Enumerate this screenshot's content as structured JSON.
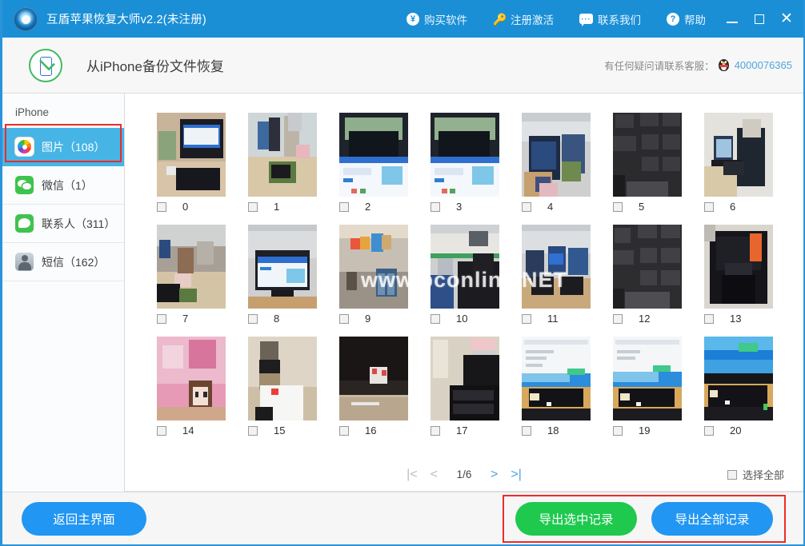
{
  "window": {
    "title": "互盾苹果恢复大师v2.2(未注册)",
    "logo_icon": "app-logo-icon",
    "menu": [
      {
        "label": "购买软件",
        "icon": "yuan-coin-icon"
      },
      {
        "label": "注册激活",
        "icon": "key-icon"
      },
      {
        "label": "联系我们",
        "icon": "chat-bubble-icon"
      },
      {
        "label": "帮助",
        "icon": "question-mark-icon"
      }
    ],
    "controls": {
      "minimize": "minimize-icon",
      "maximize": "maximize-icon",
      "close": "close-icon"
    },
    "titlebar_color": "#1a8fd6"
  },
  "subheader": {
    "badge_icon": "phone-check-icon",
    "title": "从iPhone备份文件恢复",
    "support_text": "有任何疑问请联系客服：",
    "qq_icon": "qq-penguin-icon",
    "support_number": "4000076365",
    "support_number_color": "#4da6dd"
  },
  "sidebar": {
    "header": "iPhone",
    "items": [
      {
        "label": "图片（108）",
        "icon": "photos-icon",
        "active": true,
        "highlighted": true
      },
      {
        "label": "微信（1）",
        "icon": "wechat-icon",
        "active": false,
        "highlighted": false
      },
      {
        "label": "联系人（311）",
        "icon": "contacts-icon",
        "active": false,
        "highlighted": false
      },
      {
        "label": "短信（162）",
        "icon": "sms-icon",
        "active": false,
        "highlighted": false
      }
    ],
    "active_color": "#47b4e6",
    "annotation_color": "#ef2b26"
  },
  "content": {
    "watermark": "www.pconline.NET",
    "thumbnails": [
      {
        "index": "0",
        "checked": false,
        "alt": "desk with monitor and keyboard"
      },
      {
        "index": "1",
        "checked": false,
        "alt": "office desk with mousepad"
      },
      {
        "index": "2",
        "checked": false,
        "alt": "monitor showing blue webpage"
      },
      {
        "index": "3",
        "checked": false,
        "alt": "monitor showing blue webpage"
      },
      {
        "index": "4",
        "checked": false,
        "alt": "open office with monitors"
      },
      {
        "index": "5",
        "checked": false,
        "alt": "close-up of black keyboard keys"
      },
      {
        "index": "6",
        "checked": false,
        "alt": "man working at laptop"
      },
      {
        "index": "7",
        "checked": false,
        "alt": "cluttered office desk"
      },
      {
        "index": "8",
        "checked": false,
        "alt": "monitor on desk in office"
      },
      {
        "index": "9",
        "checked": false,
        "alt": "water jugs beside shelf"
      },
      {
        "index": "10",
        "checked": false,
        "alt": "person in office chair"
      },
      {
        "index": "11",
        "checked": false,
        "alt": "office cubicles with monitors"
      },
      {
        "index": "12",
        "checked": false,
        "alt": "black keyboard close-up"
      },
      {
        "index": "13",
        "checked": false,
        "alt": "black computer mouse"
      },
      {
        "index": "14",
        "checked": false,
        "alt": "pink cartoon helmet"
      },
      {
        "index": "15",
        "checked": false,
        "alt": "cup and paper on desk"
      },
      {
        "index": "16",
        "checked": false,
        "alt": "dark fluffy cat"
      },
      {
        "index": "17",
        "checked": false,
        "alt": "glass and keyboard on desk"
      },
      {
        "index": "18",
        "checked": false,
        "alt": "monitor with blue page and desk"
      },
      {
        "index": "19",
        "checked": false,
        "alt": "monitor with blue page and desk"
      },
      {
        "index": "20",
        "checked": false,
        "alt": "bright blue monitor screen"
      }
    ],
    "pager": {
      "first_icon": "first-page-icon",
      "first_label": "|<",
      "prev_icon": "prev-page-icon",
      "prev_label": "<",
      "current": "1/6",
      "next_icon": "next-page-icon",
      "next_label": ">",
      "last_icon": "last-page-icon",
      "last_label": ">|"
    },
    "select_all": {
      "label": "选择全部",
      "checked": false
    }
  },
  "footer": {
    "back_label": "返回主界面",
    "export_selected_label": "导出选中记录",
    "export_all_label": "导出全部记录",
    "blue": "#2196f3",
    "green": "#1ec94e",
    "annotation_color": "#ef2b26"
  }
}
